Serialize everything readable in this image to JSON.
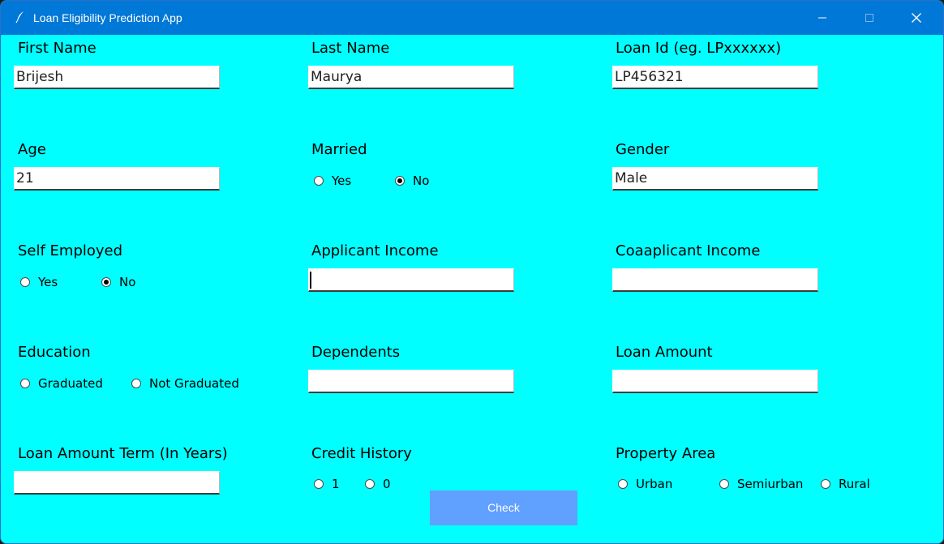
{
  "window": {
    "title": "Loan Eligibility Prediction App",
    "titlebar_color": "#0078d7",
    "background_color": "#00ffff",
    "icons": {
      "app": "feather-icon",
      "minimize": "minimize-icon",
      "maximize": "maximize-icon",
      "close": "close-icon"
    }
  },
  "fields": {
    "first_name": {
      "label": "First Name",
      "value": "Brijesh"
    },
    "last_name": {
      "label": "Last Name",
      "value": "Maurya"
    },
    "loan_id": {
      "label": "Loan Id (eg. LPxxxxxx)",
      "value": "LP456321"
    },
    "age": {
      "label": "Age",
      "value": "21"
    },
    "married": {
      "label": "Married",
      "options": [
        "Yes",
        "No"
      ],
      "selected": "No"
    },
    "gender": {
      "label": "Gender",
      "value": "Male"
    },
    "self_employed": {
      "label": "Self Employed",
      "options": [
        "Yes",
        "No"
      ],
      "selected": "No"
    },
    "applicant_income": {
      "label": "Applicant Income",
      "value": ""
    },
    "coapplicant_income": {
      "label": "Coaaplicant Income",
      "value": ""
    },
    "education": {
      "label": "Education",
      "options": [
        "Graduated",
        "Not Graduated"
      ],
      "selected": null
    },
    "dependents": {
      "label": "Dependents",
      "value": ""
    },
    "loan_amount": {
      "label": "Loan Amount",
      "value": ""
    },
    "loan_amount_term": {
      "label": "Loan Amount Term (In Years)",
      "value": ""
    },
    "credit_history": {
      "label": "Credit History",
      "options": [
        "1",
        "0"
      ],
      "selected": null
    },
    "property_area": {
      "label": "Property Area",
      "options": [
        "Urban",
        "Semiurban",
        "Rural"
      ],
      "selected": null
    }
  },
  "buttons": {
    "check": {
      "label": "Check",
      "color": "#60a0ff"
    }
  }
}
